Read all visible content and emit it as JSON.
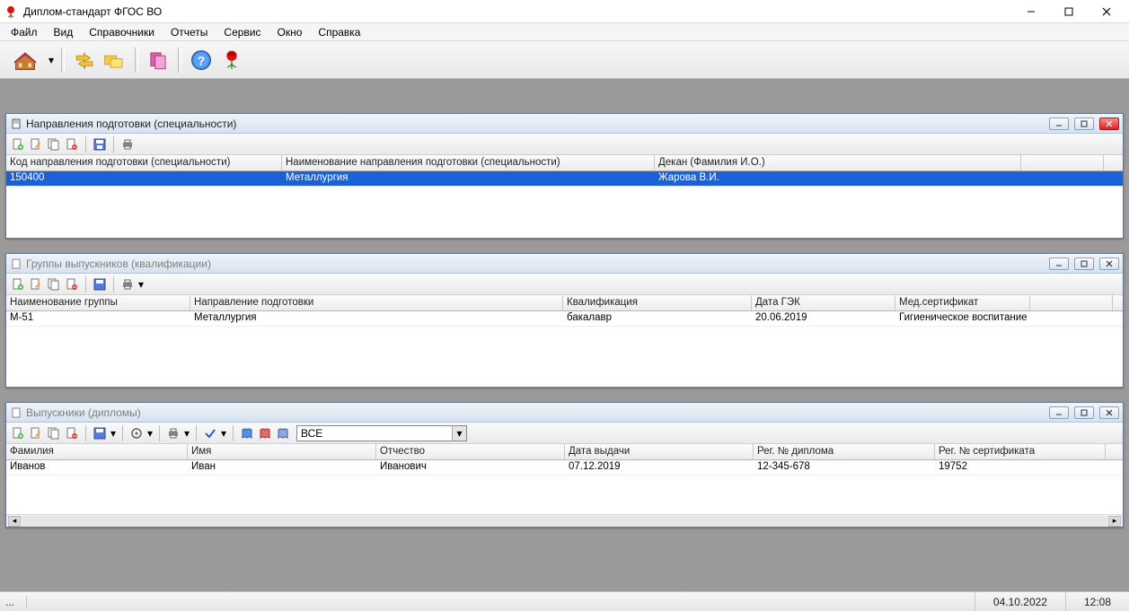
{
  "window": {
    "title": "Диплом-стандарт ФГОС ВО"
  },
  "window_controls": {
    "minimize": "—",
    "maximize": "▢",
    "close": "✕"
  },
  "menu": {
    "file": "Файл",
    "view": "Вид",
    "reference": "Справочники",
    "reports": "Отчеты",
    "service": "Сервис",
    "window": "Окно",
    "help": "Справка"
  },
  "toolbar_icons": {
    "building": "building-icon",
    "signpost": "signpost-icon",
    "folders": "folders-icon",
    "stack": "stack-icon",
    "help": "help-icon",
    "rose": "rose-icon"
  },
  "panels": {
    "directions": {
      "title": "Направления подготовки (специальности)",
      "columns": {
        "code": "Код направления подготовки (специальности)",
        "name": "Наименование направления подготовки (специальности)",
        "dean": "Декан (Фамилия И.О.)"
      },
      "rows": [
        {
          "code": "150400",
          "name": "Металлургия",
          "dean": "Жарова В.И."
        }
      ]
    },
    "groups": {
      "title": "Группы выпускников (квалификации)",
      "columns": {
        "group": "Наименование группы",
        "direction": "Направление подготовки",
        "qualification": "Квалификация",
        "date": "Дата ГЭК",
        "cert": "Мед.сертификат"
      },
      "rows": [
        {
          "group": "М-51",
          "direction": "Металлургия",
          "qualification": "бакалавр",
          "date": "20.06.2019",
          "cert": "Гигиеническое воспитание"
        }
      ]
    },
    "grads": {
      "title": "Выпускники (дипломы)",
      "filter": "ВСЕ",
      "columns": {
        "surname": "Фамилия",
        "name": "Имя",
        "patronymic": "Отчество",
        "issued": "Дата выдачи",
        "diploma": "Рег. № диплома",
        "cert": "Рег. № сертификата"
      },
      "rows": [
        {
          "surname": "Иванов",
          "name": "Иван",
          "patronymic": "Иванович",
          "issued": "07.12.2019",
          "diploma": "12-345-678",
          "cert": "19752"
        }
      ]
    }
  },
  "statusbar": {
    "ellipsis": "...",
    "date": "04.10.2022",
    "time": "12:08"
  }
}
